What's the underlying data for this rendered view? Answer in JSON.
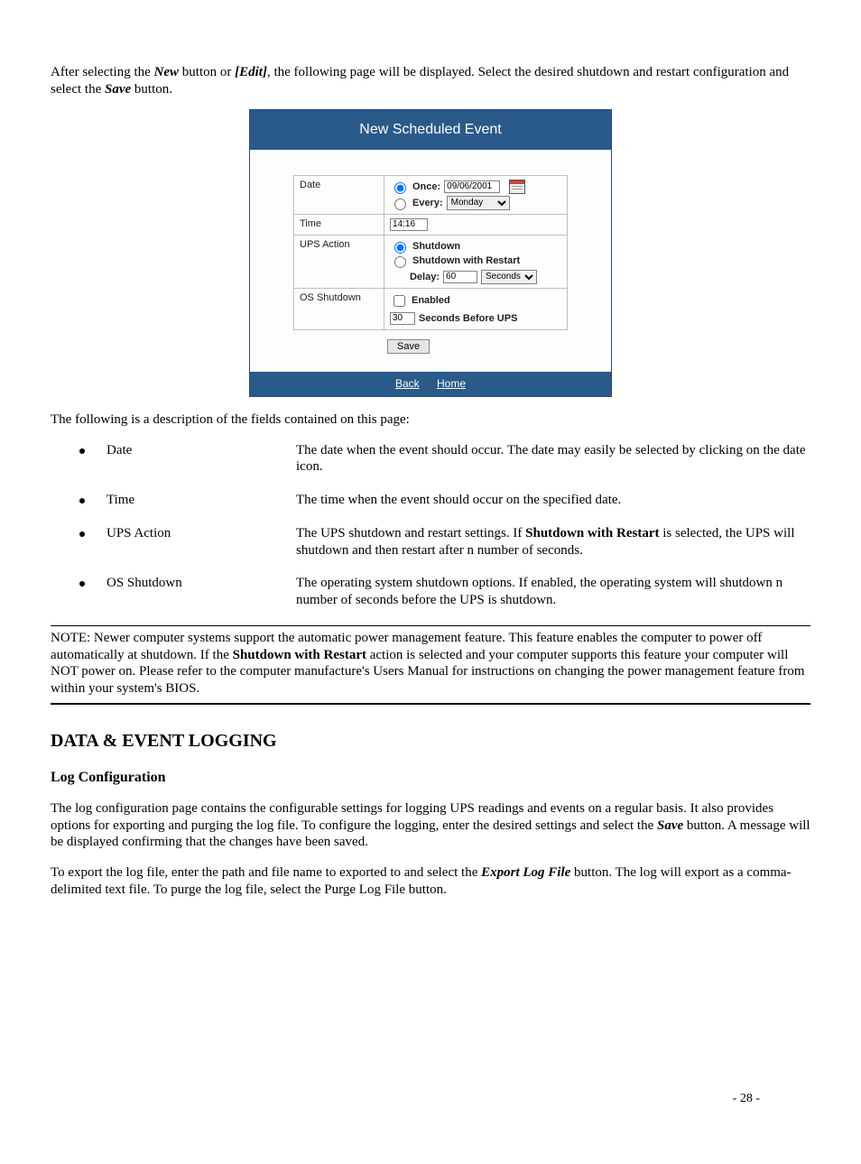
{
  "intro": {
    "p1a": "After selecting the ",
    "new": "New",
    "p1b": " button or ",
    "edit": "[Edit]",
    "p1c": ", the following page will be displayed.  Select the desired shutdown and restart configuration and select the ",
    "save": "Save",
    "p1d": " button."
  },
  "panel": {
    "title": "New Scheduled Event",
    "rows": {
      "date": {
        "label": "Date",
        "once_label": "Once:",
        "once_value": "09/06/2001",
        "every_label": "Every:",
        "every_value": "Monday"
      },
      "time": {
        "label": "Time",
        "value": "14:16"
      },
      "ups": {
        "label": "UPS Action",
        "opt1": "Shutdown",
        "opt2": "Shutdown with Restart",
        "delay_label": "Delay:",
        "delay_value": "60",
        "delay_unit": "Seconds"
      },
      "os": {
        "label": "OS Shutdown",
        "enabled": "Enabled",
        "value": "30",
        "suffix": "Seconds Before UPS"
      }
    },
    "save": "Save",
    "footer": {
      "back": "Back",
      "home": "Home"
    }
  },
  "desc_intro": "The following is a description of the fields contained on this page:",
  "desc": [
    {
      "term": "Date",
      "def": "The date when the event should occur.  The date may easily be selected by clicking on the date icon."
    },
    {
      "term": "Time",
      "def": "The time when the event should occur on the specified date."
    },
    {
      "term": "UPS Action",
      "def_a": "The UPS shutdown and restart settings.  If ",
      "bold": "Shutdown with Restart",
      "def_b": " is selected, the UPS will shutdown and then restart after n number of seconds."
    },
    {
      "term": "OS Shutdown",
      "def": "The operating system shutdown options.  If enabled, the operating system will shutdown n number of seconds before the UPS is shutdown."
    }
  ],
  "note": {
    "a": "NOTE: Newer computer systems support the automatic power management feature. This feature enables the computer to power off automatically at shutdown. If the ",
    "bold": "Shutdown with Restart",
    "b": " action is selected and your computer supports this feature your computer will NOT power on. Please refer to the computer manufacture's Users Manual for instructions on changing the power management feature from within your system's BIOS."
  },
  "section": {
    "h1": "DATA & EVENT LOGGING",
    "h2": "Log Configuration",
    "p1a": "The log configuration page contains the configurable settings for logging UPS readings and events on a regular basis.  It also provides options for exporting and purging the log file. To configure the logging, enter the desired settings and select the ",
    "save": "Save",
    "p1b": " button.  A message will be displayed confirming that the changes have been saved.",
    "p2a": "To export the log file, enter the path and file name to exported to and select the ",
    "export": "Export Log File",
    "p2b": " button. The log will export as a comma-delimited text file. To purge the log file, select the Purge Log File button."
  },
  "page_number": "- 28 -"
}
